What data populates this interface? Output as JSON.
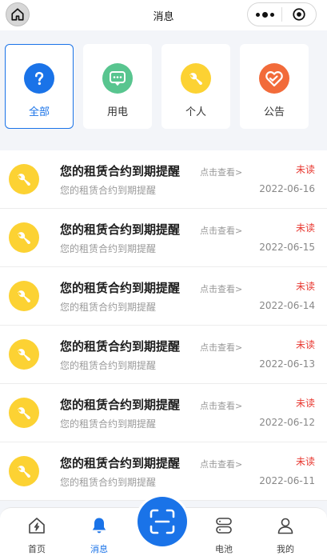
{
  "header": {
    "title": "消息"
  },
  "categories": [
    {
      "label": "全部",
      "icon": "question-icon",
      "color": "#1a73e8",
      "active": true
    },
    {
      "label": "用电",
      "icon": "chat-icon",
      "color": "#58c58f",
      "active": false
    },
    {
      "label": "个人",
      "icon": "wrench-icon",
      "color": "#fcd233",
      "active": false
    },
    {
      "label": "公告",
      "icon": "heart-icon",
      "color": "#f26b3a",
      "active": false
    }
  ],
  "messages": [
    {
      "title": "您的租赁合约到期提醒",
      "link": "点击查看>",
      "subtitle": "您的租赁合约到期提醒",
      "status": "未读",
      "date": "2022-06-16"
    },
    {
      "title": "您的租赁合约到期提醒",
      "link": "点击查看>",
      "subtitle": "您的租赁合约到期提醒",
      "status": "未读",
      "date": "2022-06-15"
    },
    {
      "title": "您的租赁合约到期提醒",
      "link": "点击查看>",
      "subtitle": "您的租赁合约到期提醒",
      "status": "未读",
      "date": "2022-06-14"
    },
    {
      "title": "您的租赁合约到期提醒",
      "link": "点击查看>",
      "subtitle": "您的租赁合约到期提醒",
      "status": "未读",
      "date": "2022-06-13"
    },
    {
      "title": "您的租赁合约到期提醒",
      "link": "点击查看>",
      "subtitle": "您的租赁合约到期提醒",
      "status": "未读",
      "date": "2022-06-12"
    },
    {
      "title": "您的租赁合约到期提醒",
      "link": "点击查看>",
      "subtitle": "您的租赁合约到期提醒",
      "status": "未读",
      "date": "2022-06-11"
    }
  ],
  "nav": {
    "home": "首页",
    "messages": "消息",
    "battery": "电池",
    "mine": "我的"
  },
  "colors": {
    "accent": "#1a73e8",
    "unread": "#e8372f",
    "avatar": "#fcd233"
  }
}
